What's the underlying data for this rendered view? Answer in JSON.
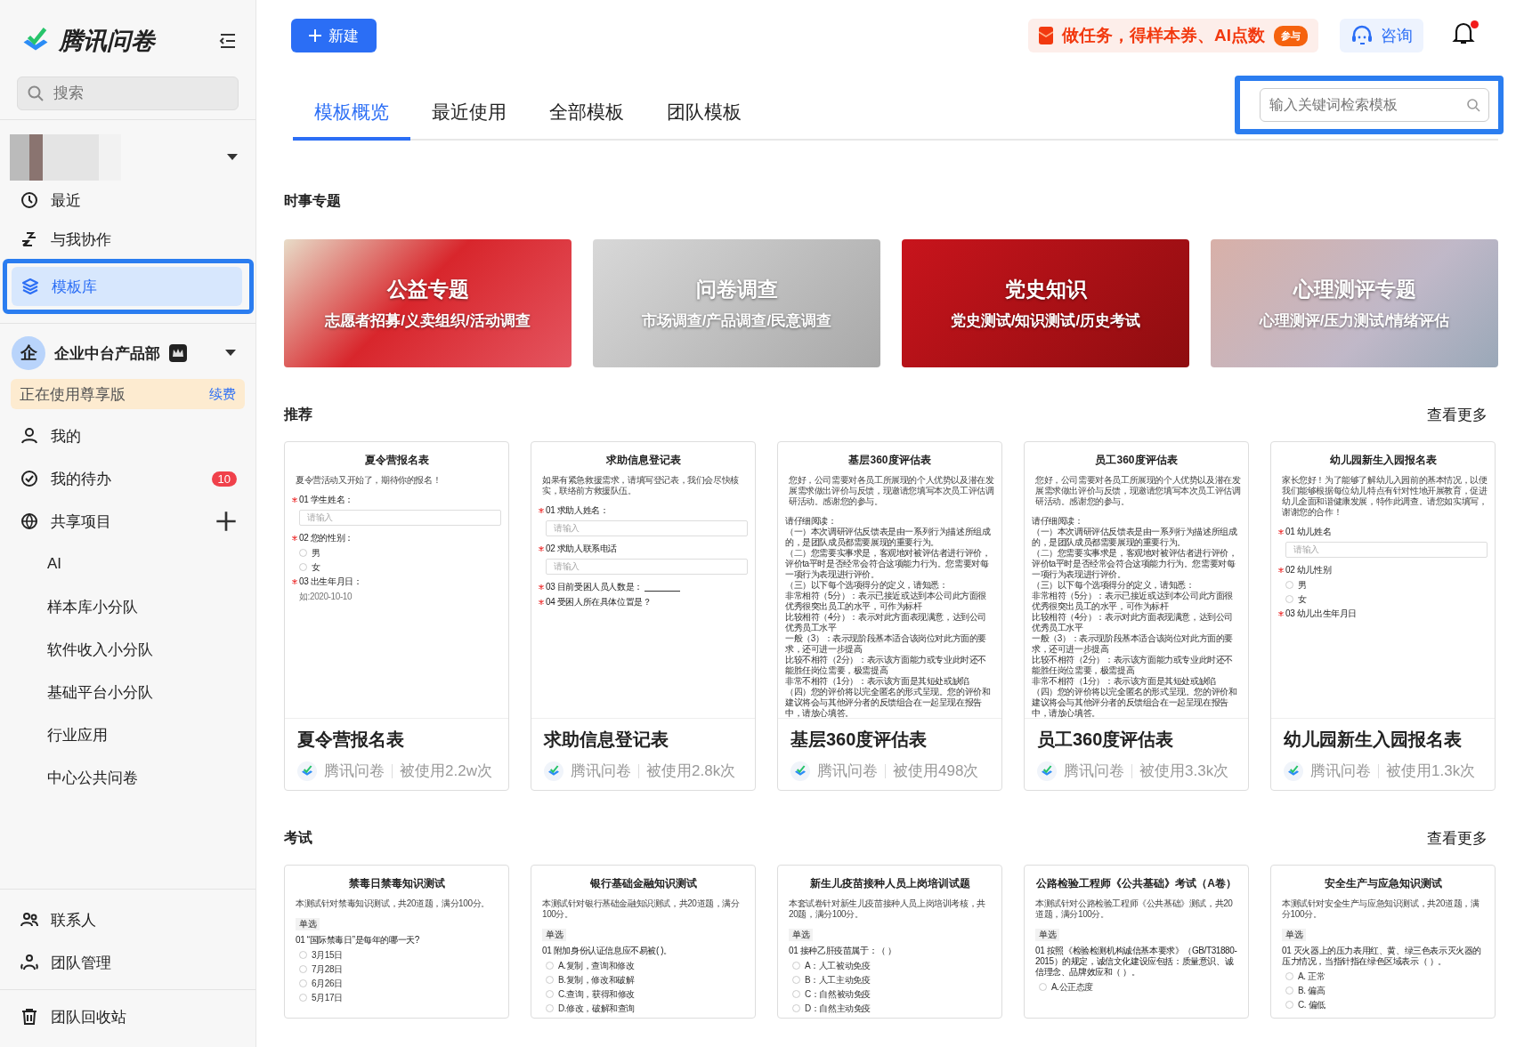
{
  "sidebar": {
    "brand": "腾讯问卷",
    "search": {
      "placeholder": "搜索"
    },
    "nav": [
      {
        "label": "最近",
        "selected": false
      },
      {
        "label": "与我协作",
        "selected": false
      },
      {
        "label": "模板库",
        "selected": true
      }
    ],
    "team": {
      "avatar": "企",
      "name": "企业中台产品部",
      "plan": "正在使用尊享版",
      "renew": "续费"
    },
    "team_items": [
      {
        "label": "我的",
        "addable": false
      },
      {
        "label": "我的待办",
        "badge": "10",
        "addable": false
      },
      {
        "label": "共享项目",
        "addable": true
      }
    ],
    "projects": [
      {
        "label": "AI"
      },
      {
        "label": "样本库小分队"
      },
      {
        "label": "软件收入小分队"
      },
      {
        "label": "基础平台小分队"
      },
      {
        "label": "行业应用"
      },
      {
        "label": "中心公共问卷"
      }
    ],
    "bottom": [
      {
        "label": "联系人"
      },
      {
        "label": "团队管理"
      },
      {
        "label": "团队回收站"
      }
    ]
  },
  "topbar": {
    "new_button": "新建",
    "promo": "做任务，得样本券、AI点数",
    "promo_badge": "参与",
    "consult": "咨询",
    "has_notification": true
  },
  "tabs": [
    {
      "label": "模板概览",
      "selected": true
    },
    {
      "label": "最近使用",
      "selected": false
    },
    {
      "label": "全部模板",
      "selected": false
    },
    {
      "label": "团队模板",
      "selected": false
    }
  ],
  "template_search": {
    "placeholder": "输入关键词检索模板"
  },
  "topics": {
    "title": "时事专题",
    "items": [
      {
        "title": "公益专题",
        "subtitle": "志愿者招募/义卖组织/活动调查"
      },
      {
        "title": "问卷调查",
        "subtitle": "市场调查/产品调查/民意调查"
      },
      {
        "title": "党史知识",
        "subtitle": "党史测试/知识测试/历史考试"
      },
      {
        "title": "心理测评专题",
        "subtitle": "心理测评/压力测试/情绪评估"
      }
    ]
  },
  "sections": [
    {
      "title": "推荐",
      "more": "查看更多",
      "cards": [
        {
          "name": "夏令营报名表",
          "author": "腾讯问卷",
          "usage": "被使用2.2w次",
          "preview": {
            "title": "夏令营报名表",
            "blocks": [
              {
                "kind": "text",
                "text": "夏令营活动又开始了，期待你的报名！"
              },
              {
                "kind": "question",
                "text": "01  学生姓名：",
                "required": true
              },
              {
                "kind": "input",
                "placeholder": "请输入"
              },
              {
                "kind": "question",
                "text": "02  您的性别：",
                "required": true
              },
              {
                "kind": "radio",
                "text": "男"
              },
              {
                "kind": "radio",
                "text": "女"
              },
              {
                "kind": "question",
                "text": "03  出生年月日：",
                "required": true
              },
              {
                "kind": "hint",
                "text": "如:2020-10-10"
              }
            ]
          }
        },
        {
          "name": "求助信息登记表",
          "author": "腾讯问卷",
          "usage": "被使用2.8k次",
          "preview": {
            "title": "求助信息登记表",
            "blocks": [
              {
                "kind": "text",
                "text": "如果有紧急救援需求，请填写登记表，我们会尽快核实，联络前方救援队伍。"
              },
              {
                "kind": "question",
                "text": "01  求助人姓名：",
                "required": true
              },
              {
                "kind": "input",
                "placeholder": "请输入"
              },
              {
                "kind": "question",
                "text": "02  求助人联系电话",
                "required": true
              },
              {
                "kind": "input",
                "placeholder": "请输入"
              },
              {
                "kind": "question",
                "text": "03  目前受困人员人数是：",
                "required": true,
                "blank": true
              },
              {
                "kind": "question",
                "text": "04  受困人所在具体位置是？",
                "required": true
              }
            ]
          }
        },
        {
          "name": "基层360度评估表",
          "author": "腾讯问卷",
          "usage": "被使用498次",
          "preview": {
            "title": "基层360度评估表",
            "blocks": [
              {
                "kind": "text",
                "text": "您好，公司需要对各员工所展现的个人优势以及潜在发展需求做出评价与反馈，现邀请您填写本次员工评估调研活动。感谢您的参与。"
              },
              {
                "kind": "para",
                "lines": [
                  "请仔细阅读：",
                  "（一）本次调研评估反馈表是由一系列行为描述所组成的，是团队成员都需要展现的重要行为。",
                  "（二）您需要实事求是，客观地对被评估者进行评价，评价ta平时是否经常会符合这项能力行为。您需要对每一项行为表现进行评价。",
                  "（三）以下每个选项得分的定义，请知悉：",
                  "非常相符（5分）：表示已接近或达到本公司此方面很优秀很突出员工的水平，可作为标杆",
                  "比较相符（4分）：表示对此方面表现满意，达到公司优秀员工水平",
                  "一般（3）：表示现阶段基本适合该岗位对此方面的要求，还可进一步提高",
                  "比较不相符（2分）：表示该方面能力或专业此时还不能胜任岗位需要，极需提高",
                  "非常不相符（1分）：表示该方面是其短处或缺陷",
                  "（四）您的评价将以完全匿名的形式呈现。您的评价和建议将会与其他评分者的反馈组合在一起呈现在报告中，请放心填答。"
                ]
              }
            ]
          }
        },
        {
          "name": "员工360度评估表",
          "author": "腾讯问卷",
          "usage": "被使用3.3k次",
          "preview": {
            "title": "员工360度评估表",
            "blocks": [
              {
                "kind": "text",
                "text": "您好，公司需要对各员工所展现的个人优势以及潜在发展需求做出评价与反馈，现邀请您填写本次员工评估调研活动。感谢您的参与。"
              },
              {
                "kind": "para",
                "lines": [
                  "请仔细阅读：",
                  "（一）本次调研评估反馈表是由一系列行为描述所组成的，是团队成员都需要展现的重要行为。",
                  "（二）您需要实事求是，客观地对被评估者进行评价，评价ta平时是否经常会符合这项能力行为。您需要对每一项行为表现进行评价。",
                  "（三）以下每个选项得分的定义，请知悉：",
                  "非常相符（5分）：表示已接近或达到本公司此方面很优秀很突出员工的水平，可作为标杆",
                  "比较相符（4分）：表示对此方面表现满意，达到公司优秀员工水平",
                  "一般（3）：表示现阶段基本适合该岗位对此方面的要求，还可进一步提高",
                  "比较不相符（2分）：表示该方面能力或专业此时还不能胜任岗位需要，极需提高",
                  "非常不相符（1分）：表示该方面是其短处或缺陷",
                  "（四）您的评价将以完全匿名的形式呈现。您的评价和建议将会与其他评分者的反馈组合在一起呈现在报告中，请放心填答。"
                ]
              }
            ]
          }
        },
        {
          "name": "幼儿园新生入园报名表",
          "author": "腾讯问卷",
          "usage": "被使用1.3k次",
          "preview": {
            "title": "幼儿园新生入园报名表",
            "blocks": [
              {
                "kind": "text",
                "text": "家长您好！为了能够了解幼儿入园前的基本情况，以便我们能够根据每位幼儿特点有针对性地开展教育，促进幼儿全面和谐健康发展，特作此调查。请您如实填写，谢谢您的合作！"
              },
              {
                "kind": "question",
                "text": "01  幼儿姓名",
                "required": true
              },
              {
                "kind": "input",
                "placeholder": "请输入"
              },
              {
                "kind": "question",
                "text": "02  幼儿性别",
                "required": true
              },
              {
                "kind": "radio",
                "text": "男"
              },
              {
                "kind": "radio",
                "text": "女"
              },
              {
                "kind": "question",
                "text": "03  幼儿出生年月日",
                "required": true
              }
            ]
          }
        }
      ]
    },
    {
      "title": "考试",
      "more": "查看更多",
      "cards": [
        {
          "preview": {
            "title": "禁毒日禁毒知识测试",
            "blocks": [
              {
                "kind": "text",
                "text": "本测试针对禁毒知识测试，共20道题，满分100分。"
              },
              {
                "kind": "tag",
                "text": "单选"
              },
              {
                "kind": "question",
                "text": "01  “国际禁毒日”是每年的哪一天?",
                "required": false
              },
              {
                "kind": "radio",
                "text": "3月15日"
              },
              {
                "kind": "radio",
                "text": "7月28日"
              },
              {
                "kind": "radio",
                "text": "6月26日"
              },
              {
                "kind": "radio",
                "text": "5月17日"
              }
            ]
          }
        },
        {
          "preview": {
            "title": "银行基础金融知识测试",
            "blocks": [
              {
                "kind": "text",
                "text": "本测试针对银行基础金融知识测试，共20道题，满分100分。"
              },
              {
                "kind": "tag",
                "text": "单选"
              },
              {
                "kind": "question",
                "text": "01  附加身份认证信息应不易被( )。",
                "required": false
              },
              {
                "kind": "radio",
                "text": "A.复制，查询和修改"
              },
              {
                "kind": "radio",
                "text": "B.复制，修改和破解"
              },
              {
                "kind": "radio",
                "text": "C.查询，获得和修改"
              },
              {
                "kind": "radio",
                "text": "D.修改，破解和查询"
              }
            ]
          }
        },
        {
          "preview": {
            "title": "新生儿疫苗接种人员上岗培训试题",
            "blocks": [
              {
                "kind": "text",
                "text": "本套试卷针对新生儿疫苗接种人员上岗培训考核，共20题，满分100分。"
              },
              {
                "kind": "tag",
                "text": "单选"
              },
              {
                "kind": "question",
                "text": "01  接种乙肝疫苗属于：（ ）",
                "required": false
              },
              {
                "kind": "radio",
                "text": "A：人工被动免疫"
              },
              {
                "kind": "radio",
                "text": "B：人工主动免疫"
              },
              {
                "kind": "radio",
                "text": "C：自然被动免疫"
              },
              {
                "kind": "radio",
                "text": "D：自然主动免疫"
              }
            ]
          }
        },
        {
          "preview": {
            "title": "公路检验工程师《公共基础》考试（A卷）",
            "blocks": [
              {
                "kind": "text",
                "text": "本测试针对公路检验工程师《公共基础》测试，共20道题，满分100分。"
              },
              {
                "kind": "tag",
                "text": "单选"
              },
              {
                "kind": "question",
                "text": "01  按照《检验检测机构诚信基本要求》（GB/T31880-2015）的规定，诚信文化建设应包括：质量意识、诚信理念、品牌效应和（ ）。",
                "required": false
              },
              {
                "kind": "radio",
                "text": "A.公正态度"
              }
            ]
          }
        },
        {
          "preview": {
            "title": "安全生产与应急知识测试",
            "blocks": [
              {
                "kind": "text",
                "text": "本测试针对安全生产与应急知识测试，共20道题，满分100分。"
              },
              {
                "kind": "tag",
                "text": "单选"
              },
              {
                "kind": "question",
                "text": "01  灭火器上的压力表用红、黄、绿三色表示灭火器的压力情况，当指针指在绿色区域表示（ ）。",
                "required": false
              },
              {
                "kind": "radio",
                "text": "A. 正常"
              },
              {
                "kind": "radio",
                "text": "B. 偏高"
              },
              {
                "kind": "radio",
                "text": "C. 偏低"
              }
            ]
          }
        }
      ]
    }
  ]
}
